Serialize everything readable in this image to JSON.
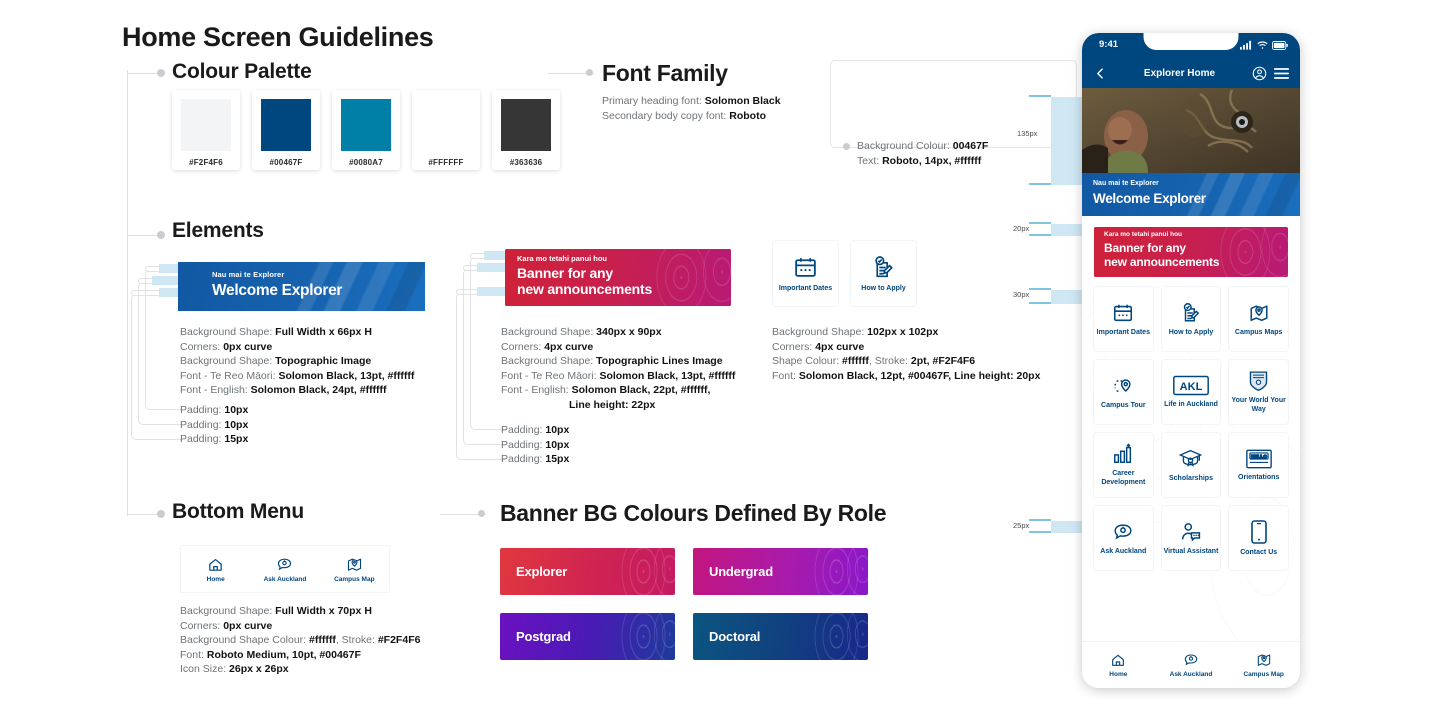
{
  "page_title": "Home Screen Guidelines",
  "sections": {
    "colour_palette": {
      "heading": "Colour Palette",
      "swatches": [
        {
          "hex": "#F2F4F6",
          "label": "#F2F4F6"
        },
        {
          "hex": "#00467F",
          "label": "#00467F"
        },
        {
          "hex": "#0080A7",
          "label": "#0080A7"
        },
        {
          "hex": "#FFFFFF",
          "label": "#FFFFFF"
        },
        {
          "hex": "#363636",
          "label": "#363636"
        }
      ]
    },
    "font_family": {
      "heading": "Font Family",
      "primary_label": "Primary heading font: ",
      "primary_value": "Solomon Black",
      "secondary_label": "Secondary body copy font: ",
      "secondary_value": "Roboto"
    },
    "nav_spec": {
      "bg_label": "Background Colour: ",
      "bg_value": "00467F",
      "text_label": "Text: ",
      "text_value": "Roboto, 14px, #ffffff"
    },
    "elements": {
      "heading": "Elements",
      "welcome_banner": {
        "te_reo": "Nau mai te Explorer",
        "english": "Welcome Explorer",
        "specs": [
          {
            "label": "Background Shape: ",
            "value": "Full Width x 66px H"
          },
          {
            "label": "Corners: ",
            "value": "0px curve"
          },
          {
            "label": "Background  Shape: ",
            "value": "Topographic Image"
          },
          {
            "label": "Font - Te Reo Māori: ",
            "value": "Solomon Black, 13pt, #ffffff"
          },
          {
            "label": "Font - English: ",
            "value": "Solomon Black, 24pt, #ffffff"
          }
        ],
        "padding": [
          {
            "label": "Padding: ",
            "value": "10px"
          },
          {
            "label": "Padding: ",
            "value": "10px"
          },
          {
            "label": "Padding: ",
            "value": "15px"
          }
        ]
      },
      "announcement_banner": {
        "te_reo": "Kara mo tetahi panui hou",
        "english_line1": "Banner for any",
        "english_line2": "new announcements",
        "specs": [
          {
            "label": "Background Shape: ",
            "value": "340px x 90px"
          },
          {
            "label": "Corners: ",
            "value": "4px curve"
          },
          {
            "label": "Background  Shape: ",
            "value": "Topographic Lines Image"
          },
          {
            "label": "Font - Te Reo Māori: ",
            "value": "Solomon Black, 13pt, #ffffff"
          },
          {
            "label": "Font - English: ",
            "value": "Solomon Black, 22pt, #ffffff,"
          },
          {
            "label": "",
            "value": "Line height: 22px"
          }
        ],
        "padding": [
          {
            "label": "Padding: ",
            "value": "10px"
          },
          {
            "label": "Padding: ",
            "value": "10px"
          },
          {
            "label": "Padding: ",
            "value": "15px"
          }
        ]
      },
      "tiles": {
        "items": [
          {
            "label": "Important Dates",
            "icon": "calendar-icon"
          },
          {
            "label": "How to Apply",
            "icon": "document-check-pencil-icon"
          }
        ],
        "specs": [
          {
            "label": "Background Shape: ",
            "value": "102px x 102px"
          },
          {
            "label": "Corners: ",
            "value": "4px curve"
          },
          {
            "label": "Shape Colour: ",
            "value": "#ffffff",
            "label2": ", Stroke: ",
            "value2": "2pt, #F2F4F6"
          },
          {
            "label": "Font: ",
            "value": "Solomon Black, 12pt, #00467F, Line height: 20px"
          }
        ]
      }
    },
    "bottom_menu": {
      "heading": "Bottom Menu",
      "items": [
        {
          "label": "Home",
          "icon": "home-icon"
        },
        {
          "label": "Ask Auckland",
          "icon": "chat-bubble-icon"
        },
        {
          "label": "Campus Map",
          "icon": "map-pin-icon"
        }
      ],
      "specs": [
        {
          "label": "Background Shape: ",
          "value": "Full Width x 70px H"
        },
        {
          "label": "Corners: ",
          "value": "0px curve"
        },
        {
          "label": "Background  Shape Colour: ",
          "value": "#ffffff",
          "label2": ", Stroke: ",
          "value2": "#F2F4F6"
        },
        {
          "label": "Font: ",
          "value": "Roboto Medium, 10pt, #00467F"
        },
        {
          "label": "Icon Size: ",
          "value": "26px x 26px"
        }
      ]
    },
    "banner_bg_colours": {
      "heading": "Banner BG Colours Defined By Role",
      "roles": [
        {
          "label": "Explorer",
          "gradient": "linear-gradient(100deg,#e0383f 0%,#cf2352 55%,#c41a63 100%)"
        },
        {
          "label": "Undergrad",
          "gradient": "linear-gradient(100deg,#c2157f 0%,#a81bab 55%,#8a17c9 100%)"
        },
        {
          "label": "Postgrad",
          "gradient": "linear-gradient(100deg,#6b11c0 0%,#4a1ab5 50%,#1e3a9b 100%)"
        },
        {
          "label": "Doctoral",
          "gradient": "linear-gradient(100deg,#0a5580 0%,#11417f 50%,#18288c 100%)"
        }
      ]
    }
  },
  "phone": {
    "status": {
      "time": "9:41",
      "signal_icon": "signal-bars-icon",
      "wifi_icon": "wifi-icon",
      "battery_icon": "battery-icon"
    },
    "nav": {
      "back_icon": "chevron-left-icon",
      "title": "Explorer Home",
      "account_icon": "account-circle-icon",
      "menu_icon": "hamburger-menu-icon"
    },
    "welcome": {
      "te_reo": "Nau mai te Explorer",
      "english": "Welcome Explorer"
    },
    "announcement": {
      "te_reo": "Kara mo tetahi panui hou",
      "line1": "Banner for any",
      "line2": "new announcements"
    },
    "grid": [
      {
        "label": "Important Dates",
        "icon": "calendar-icon"
      },
      {
        "label": "How to Apply",
        "icon": "document-check-pencil-icon"
      },
      {
        "label": "Campus Maps",
        "icon": "map-pin-icon"
      },
      {
        "label": "Campus Tour",
        "icon": "tour-route-pin-icon"
      },
      {
        "label": "Life in Auckland",
        "icon": "akl-badge-icon"
      },
      {
        "label": "Your World Your Way",
        "icon": "shield-crest-icon"
      },
      {
        "label": "Career Development",
        "icon": "bar-chart-arrow-icon"
      },
      {
        "label": "Scholarships",
        "icon": "graduation-cap-icon"
      },
      {
        "label": "Orientations",
        "icon": "hello-badge-icon"
      },
      {
        "label": "Ask Auckland",
        "icon": "chat-bubble-icon"
      },
      {
        "label": "Virtual Assistant",
        "icon": "person-chat-icon"
      },
      {
        "label": "Contact Us",
        "icon": "mobile-phone-icon"
      }
    ],
    "bottom": [
      {
        "label": "Home",
        "icon": "home-icon"
      },
      {
        "label": "Ask Auckland",
        "icon": "chat-bubble-icon"
      },
      {
        "label": "Campus Map",
        "icon": "map-pin-icon"
      }
    ]
  },
  "measurements": [
    {
      "value": "135px"
    },
    {
      "value": "20px"
    },
    {
      "value": "30px"
    },
    {
      "value": "25px"
    }
  ]
}
